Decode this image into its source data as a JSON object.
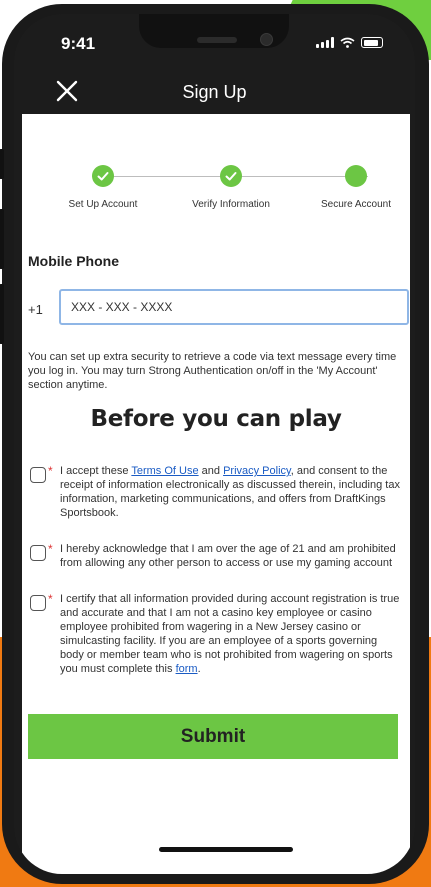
{
  "status_bar": {
    "time": "9:41"
  },
  "nav": {
    "title": "Sign Up",
    "close_icon": "close-icon"
  },
  "stepper": {
    "steps": [
      {
        "label": "Set Up Account",
        "state": "complete"
      },
      {
        "label": "Verify Information",
        "state": "complete"
      },
      {
        "label": "Secure Account",
        "state": "current"
      }
    ]
  },
  "mobile_phone": {
    "title": "Mobile Phone",
    "country_code": "+1",
    "placeholder": "XXX - XXX - XXXX",
    "info": "You can set up extra security to retrieve a code via text message every time you log in. You may turn Strong Authentication on/off in the 'My Account' section anytime."
  },
  "before_play": {
    "heading": "Before you can play"
  },
  "consents": [
    {
      "pre": "I accept these ",
      "link1": "Terms Of Use",
      "mid": " and ",
      "link2": "Privacy Policy",
      "post": ", and consent to the receipt of information electronically as discussed therein, including tax information, marketing communications, and offers from DraftKings Sportsbook."
    },
    {
      "text": "I hereby acknowledge that I am over the age of 21 and am prohibited from allowing any other person to access or use my gaming account"
    },
    {
      "pre": "I certify that all information provided during account registration is true and accurate and that I am not a casino key employee or casino employee prohibited from wagering in a New Jersey casino or simulcasting facility. If you are an employee of a sports governing body or member team who is not prohibited from wagering on sports you must complete this ",
      "link": "form",
      "post": "."
    }
  ],
  "submit": {
    "label": "Submit"
  },
  "colors": {
    "accent_green": "#6cc644",
    "link_blue": "#1a5bc4",
    "input_border": "#8fb6e6",
    "bg_orange": "#f07a12"
  }
}
